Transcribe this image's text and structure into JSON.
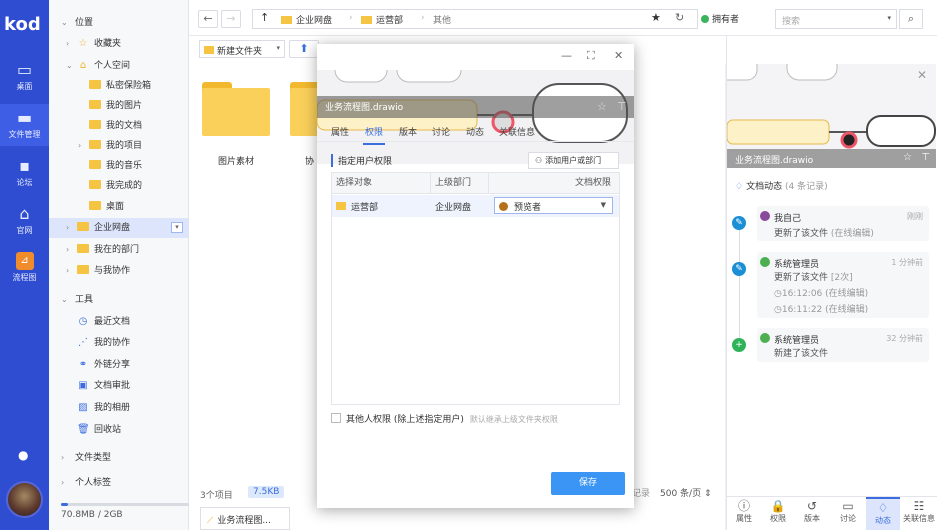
{
  "app": {
    "logo": "kod"
  },
  "rail": [
    {
      "label": "桌面",
      "icon": "monitor-icon"
    },
    {
      "label": "文件管理",
      "icon": "folder-icon"
    },
    {
      "label": "论坛",
      "icon": "chat-icon"
    },
    {
      "label": "官网",
      "icon": "home-icon"
    },
    {
      "label": "流程图",
      "icon": "flowchart-icon"
    }
  ],
  "tree": {
    "location_header": "位置",
    "favorites": "收藏夹",
    "personal_space": "个人空间",
    "personal_items": [
      "私密保险箱",
      "我的图片",
      "我的文档",
      "我的项目",
      "我的音乐",
      "我完成的",
      "桌面"
    ],
    "enterprise_disk": "企业网盘",
    "my_department": "我在的部门",
    "collab_with_me": "与我协作",
    "tools_header": "工具",
    "tools": [
      "最近文档",
      "我的协作",
      "外链分享",
      "文档审批",
      "我的相册",
      "回收站"
    ],
    "file_types": "文件类型",
    "personal_tags": "个人标签",
    "quota": "70.8MB / 2GB",
    "quota_fraction": 0.04
  },
  "toolbar": {
    "crumbs": [
      "企业网盘",
      "运营部",
      "其他"
    ],
    "owner_label": "拥有者",
    "search_placeholder": "搜索",
    "new_folder": "新建文件夹"
  },
  "content": {
    "folders": [
      "图片素材",
      "协"
    ],
    "item_count": "3个项目",
    "size": "7.5KB",
    "per_page": "500 条/页",
    "record_fragment": "记录",
    "task_label": "业务流程图..."
  },
  "modal": {
    "file_name": "业务流程图.drawio",
    "tabs": [
      "属性",
      "权限",
      "版本",
      "讨论",
      "动态",
      "关联信息"
    ],
    "active_tab": "权限",
    "section_title": "指定用户权限",
    "add_button": "添加用户或部门",
    "columns": [
      "选择对象",
      "上级部门",
      "文档权限"
    ],
    "row": {
      "object": "运营部",
      "parent": "企业网盘",
      "permission": "预览者",
      "permission_color": "#b5701c"
    },
    "others_label": "其他人权限 (除上述指定用户)",
    "others_hint": "默认继承上级文件夹权限",
    "save_button": "保存"
  },
  "right_panel": {
    "file_name": "业务流程图.drawio",
    "section_title": "文档动态",
    "section_count": "(4 条记录)",
    "events": [
      {
        "user": "我自己",
        "time": "刚刚",
        "lines": [
          {
            "text": "更新了该文件",
            "note": "(在线编辑)"
          }
        ],
        "dot": "edit",
        "dot_color": "#1a8fd6"
      },
      {
        "user": "系统管理员",
        "time": "1 分钟前",
        "lines": [
          {
            "text": "更新了该文件",
            "note": "[2次]"
          },
          {
            "text": "16:12:06",
            "note": "(在线编辑)"
          },
          {
            "text": "16:11:22",
            "note": "(在线编辑)"
          }
        ],
        "dot": "edit",
        "dot_color": "#1a8fd6"
      },
      {
        "user": "系统管理员",
        "time": "32 分钟前",
        "lines": [
          {
            "text": "新建了该文件",
            "note": ""
          }
        ],
        "dot": "add",
        "dot_color": "#2fb35a"
      }
    ],
    "tabs": [
      "属性",
      "权限",
      "版本",
      "讨论",
      "动态",
      "关联信息"
    ],
    "active_tab": "动态"
  }
}
